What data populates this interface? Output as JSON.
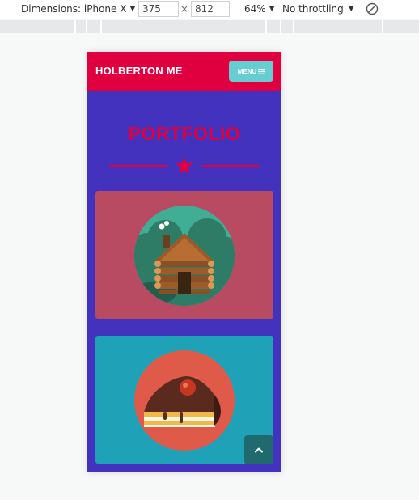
{
  "devtools": {
    "dimensions_label": "Dimensions: iPhone X",
    "width_value": "375",
    "height_value": "812",
    "times_symbol": "×",
    "zoom_label": "64%",
    "throttle_label": "No throttling"
  },
  "site": {
    "brand": "HOLBERTON ME",
    "menu_label": "MENU",
    "section_title": "PORTFOLIO"
  },
  "colors": {
    "nav_bg": "#e0003f",
    "page_bg": "#4332bd",
    "menu_btn": "#66cdd0",
    "card_cabin": "#b84a62",
    "card_cake": "#1fa1b7",
    "back_to_top": "#1f6a6d"
  },
  "icons": {
    "menu": "hamburger-icon",
    "divider": "star-icon",
    "card_1": "log-cabin-illustration",
    "card_2": "cake-slice-illustration",
    "back_to_top": "chevron-up-icon",
    "rotate": "rotate-device-icon"
  }
}
